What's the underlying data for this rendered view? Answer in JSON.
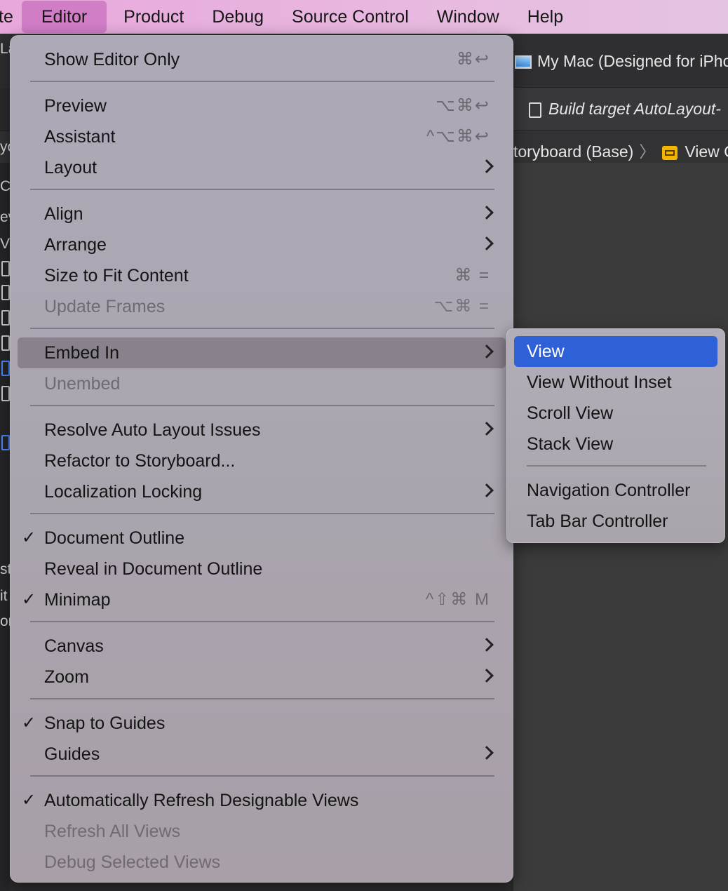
{
  "menubar": {
    "items": [
      "te",
      "Editor",
      "Product",
      "Debug",
      "Source Control",
      "Window",
      "Help"
    ]
  },
  "background": {
    "device": "My Mac (Designed for iPho",
    "build_status": "Build target AutoLayout-",
    "breadcrumb_storyboard": "toryboard (Base)",
    "breadcrumb_view": "View C",
    "left_fragments": [
      "La",
      "yo",
      "C",
      "ev",
      "V",
      "st",
      "it",
      "or"
    ]
  },
  "editor_menu": {
    "items": [
      {
        "label": "Show Editor Only",
        "shortcut": "⌘↩",
        "checked": false,
        "disabled": false,
        "submenu": false
      },
      {
        "label": "Preview",
        "shortcut": "⌥⌘↩",
        "checked": false,
        "disabled": false,
        "submenu": false
      },
      {
        "label": "Assistant",
        "shortcut": "^⌥⌘↩",
        "checked": false,
        "disabled": false,
        "submenu": false
      },
      {
        "label": "Layout",
        "shortcut": "",
        "checked": false,
        "disabled": false,
        "submenu": true
      },
      {
        "label": "Align",
        "shortcut": "",
        "checked": false,
        "disabled": false,
        "submenu": true
      },
      {
        "label": "Arrange",
        "shortcut": "",
        "checked": false,
        "disabled": false,
        "submenu": true
      },
      {
        "label": "Size to Fit Content",
        "shortcut": "⌘ =",
        "checked": false,
        "disabled": false,
        "submenu": false
      },
      {
        "label": "Update Frames",
        "shortcut": "⌥⌘ =",
        "checked": false,
        "disabled": true,
        "submenu": false
      },
      {
        "label": "Embed In",
        "shortcut": "",
        "checked": false,
        "disabled": false,
        "submenu": true
      },
      {
        "label": "Unembed",
        "shortcut": "",
        "checked": false,
        "disabled": true,
        "submenu": false
      },
      {
        "label": "Resolve Auto Layout Issues",
        "shortcut": "",
        "checked": false,
        "disabled": false,
        "submenu": true
      },
      {
        "label": "Refactor to Storyboard...",
        "shortcut": "",
        "checked": false,
        "disabled": false,
        "submenu": false
      },
      {
        "label": "Localization Locking",
        "shortcut": "",
        "checked": false,
        "disabled": false,
        "submenu": true
      },
      {
        "label": "Document Outline",
        "shortcut": "",
        "checked": true,
        "disabled": false,
        "submenu": false
      },
      {
        "label": "Reveal in Document Outline",
        "shortcut": "",
        "checked": false,
        "disabled": false,
        "submenu": false
      },
      {
        "label": "Minimap",
        "shortcut": "^⇧⌘ M",
        "checked": true,
        "disabled": false,
        "submenu": false
      },
      {
        "label": "Canvas",
        "shortcut": "",
        "checked": false,
        "disabled": false,
        "submenu": true
      },
      {
        "label": "Zoom",
        "shortcut": "",
        "checked": false,
        "disabled": false,
        "submenu": true
      },
      {
        "label": "Snap to Guides",
        "shortcut": "",
        "checked": true,
        "disabled": false,
        "submenu": false
      },
      {
        "label": "Guides",
        "shortcut": "",
        "checked": false,
        "disabled": false,
        "submenu": true
      },
      {
        "label": "Automatically Refresh Designable Views",
        "shortcut": "",
        "checked": true,
        "disabled": false,
        "submenu": false
      },
      {
        "label": "Refresh All Views",
        "shortcut": "",
        "checked": false,
        "disabled": true,
        "submenu": false
      },
      {
        "label": "Debug Selected Views",
        "shortcut": "",
        "checked": false,
        "disabled": true,
        "submenu": false
      }
    ],
    "check_glyph": "✓"
  },
  "embed_submenu": {
    "items": [
      "View",
      "View Without Inset",
      "Scroll View",
      "Stack View",
      "Navigation Controller",
      "Tab Bar Controller"
    ]
  },
  "colors": {
    "selection": "#2e60d8",
    "menubar_active": "#c46bbe"
  }
}
